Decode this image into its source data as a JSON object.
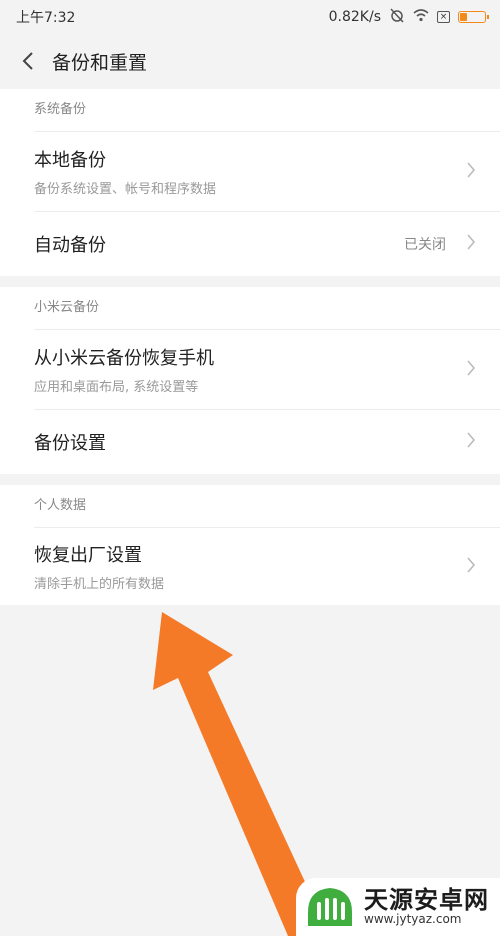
{
  "status_bar": {
    "time": "上午7:32",
    "net_speed": "0.82K/s"
  },
  "header": {
    "title": "备份和重置"
  },
  "sections": [
    {
      "label": "系统备份",
      "rows": [
        {
          "title": "本地备份",
          "subtitle": "备份系统设置、帐号和程序数据"
        },
        {
          "title": "自动备份",
          "value": "已关闭"
        }
      ]
    },
    {
      "label": "小米云备份",
      "rows": [
        {
          "title": "从小米云备份恢复手机",
          "subtitle": "应用和桌面布局, 系统设置等"
        },
        {
          "title": "备份设置"
        }
      ]
    },
    {
      "label": "个人数据",
      "rows": [
        {
          "title": "恢复出厂设置",
          "subtitle": "清除手机上的所有数据"
        }
      ]
    }
  ],
  "annotation": {
    "arrow_color": "#f47a28"
  },
  "watermark": {
    "name": "天源安卓网",
    "url": "www.jytyaz.com",
    "color": "#3fae3f"
  }
}
